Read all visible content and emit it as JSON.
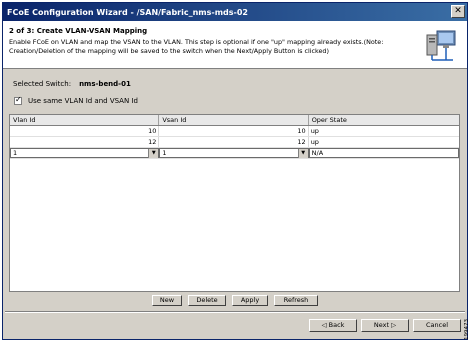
{
  "window": {
    "title": "FCoE Configuration Wizard - /SAN/Fabric_nms-mds-02"
  },
  "header": {
    "step_title": "2 of 3: Create VLAN-VSAN Mapping",
    "description": "Enable FCoE on VLAN and map the VSAN to the VLAN.  This step is optional if one \"up\" mapping already exists.(Note: Creation/Deletion of the mapping will be saved to the switch when the Next/Apply Button is clicked)",
    "icon": "network-computer-icon"
  },
  "switch": {
    "label": "Selected Switch:",
    "value": "nms-bend-01"
  },
  "checkbox": {
    "label": "Use same VLAN Id and VSAN Id",
    "checked": true
  },
  "table": {
    "columns": [
      "Vlan Id",
      "Vsan Id",
      "Oper State"
    ],
    "rows": [
      [
        "10",
        "10",
        "up"
      ],
      [
        "12",
        "12",
        "up"
      ]
    ],
    "edit_row": {
      "vlan": "1",
      "vsan": "1",
      "state": "N/A"
    }
  },
  "buttons": {
    "new": "New",
    "delete": "Delete",
    "apply": "Apply",
    "refresh": "Refresh"
  },
  "nav": {
    "back": "Back",
    "next": "Next",
    "cancel": "Cancel"
  },
  "figure_id": "199473",
  "colors": {
    "titlebar": "#0a246a",
    "panel": "#d4d0c8"
  }
}
